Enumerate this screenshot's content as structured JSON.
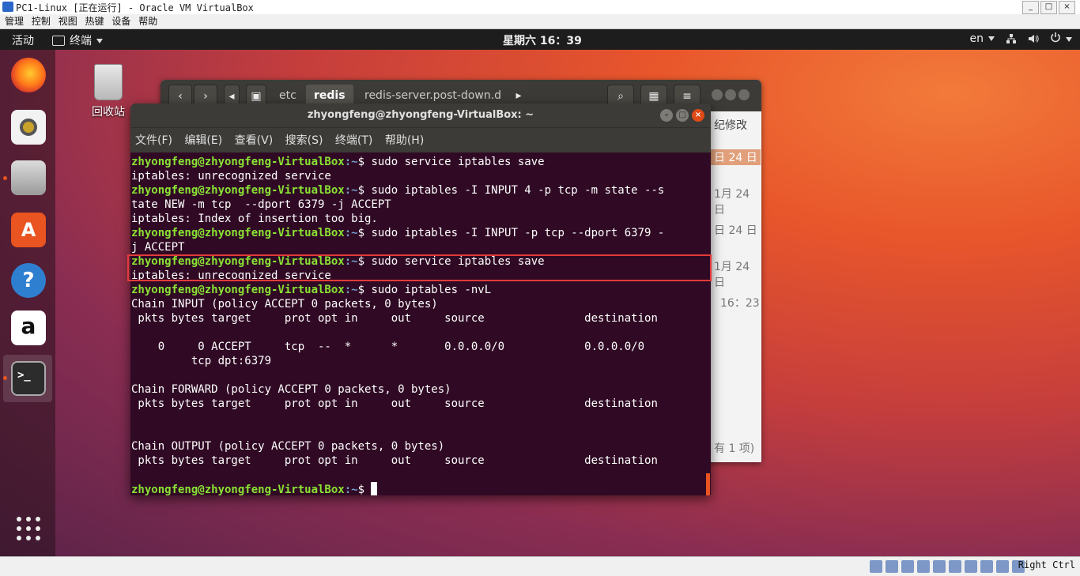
{
  "host": {
    "window_title": "PC1-Linux [正在运行] - Oracle VM VirtualBox",
    "menu": [
      "管理",
      "控制",
      "视图",
      "热键",
      "设备",
      "帮助"
    ],
    "title_buttons": [
      "_",
      "□",
      "×"
    ],
    "host_key": "Right Ctrl"
  },
  "topbar": {
    "activities": "活动",
    "app_menu": "终端",
    "clock": "星期六 16：39",
    "lang": "en"
  },
  "desktop": {
    "trash_label": "回收站"
  },
  "file_manager": {
    "breadcrumbs": [
      "etc",
      "redis",
      "redis-server.post-down.d"
    ],
    "side_texts": [
      "纪修改",
      "日 24 日",
      "1月 24 日",
      "日 24 日",
      "1月 24 日",
      "16：23",
      "有 1 项)"
    ]
  },
  "terminal": {
    "title": "zhyongfeng@zhyongfeng-VirtualBox: ~",
    "menu": [
      "文件(F)",
      "编辑(E)",
      "查看(V)",
      "搜索(S)",
      "终端(T)",
      "帮助(H)"
    ],
    "prompt_user": "zhyongfeng@zhyongfeng-VirtualBox",
    "prompt_path": ":~",
    "prompt_sign": "$ ",
    "lines": [
      {
        "cmd": "sudo service iptables save"
      },
      {
        "out": "iptables: unrecognized service"
      },
      {
        "cmd": "sudo iptables -I INPUT 4 -p tcp -m state --s"
      },
      {
        "out": "tate NEW -m tcp  --dport 6379 -j ACCEPT"
      },
      {
        "out": "iptables: Index of insertion too big."
      },
      {
        "cmd": "sudo iptables -I INPUT -p tcp --dport 6379 -"
      },
      {
        "out": "j ACCEPT"
      },
      {
        "cmd": "sudo service iptables save"
      },
      {
        "out": "iptables: unrecognized service"
      },
      {
        "cmd": "sudo iptables -nvL"
      },
      {
        "out": "Chain INPUT (policy ACCEPT 0 packets, 0 bytes)"
      },
      {
        "out": " pkts bytes target     prot opt in     out     source               destination"
      },
      {
        "out": ""
      },
      {
        "out": "    0     0 ACCEPT     tcp  --  *      *       0.0.0.0/0            0.0.0.0/0"
      },
      {
        "out": "         tcp dpt:6379"
      },
      {
        "out": ""
      },
      {
        "out": "Chain FORWARD (policy ACCEPT 0 packets, 0 bytes)"
      },
      {
        "out": " pkts bytes target     prot opt in     out     source               destination"
      },
      {
        "out": ""
      },
      {
        "out": ""
      },
      {
        "out": "Chain OUTPUT (policy ACCEPT 0 packets, 0 bytes)"
      },
      {
        "out": " pkts bytes target     prot opt in     out     source               destination"
      },
      {
        "out": ""
      },
      {
        "cmd": ""
      }
    ]
  }
}
